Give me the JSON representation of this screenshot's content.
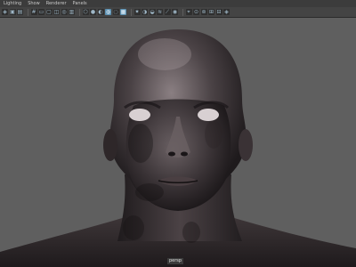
{
  "menubar": {
    "items": [
      "Lighting",
      "Show",
      "Renderer",
      "Panels"
    ]
  },
  "toolbar": {
    "icons": [
      {
        "name": "select-camera-icon",
        "glyph": "◈",
        "active": false
      },
      {
        "name": "bookmark-icon",
        "glyph": "▣",
        "active": false
      },
      {
        "name": "image-plane-icon",
        "glyph": "▤",
        "active": false
      },
      {
        "name": "grid-icon",
        "glyph": "#",
        "active": false
      },
      {
        "name": "film-gate-icon",
        "glyph": "▭",
        "active": false
      },
      {
        "name": "resolution-gate-icon",
        "glyph": "▢",
        "active": false
      },
      {
        "name": "gate-mask-icon",
        "glyph": "◫",
        "active": false
      },
      {
        "name": "field-chart-icon",
        "glyph": "◎",
        "active": false
      },
      {
        "name": "safe-action-icon",
        "glyph": "▥",
        "active": false
      },
      {
        "name": "wireframe-icon",
        "glyph": "⬡",
        "active": false
      },
      {
        "name": "smooth-shade-icon",
        "glyph": "●",
        "active": false
      },
      {
        "name": "default-material-icon",
        "glyph": "◐",
        "active": false
      },
      {
        "name": "wireframe-on-shaded-icon",
        "glyph": "◍",
        "active": true
      },
      {
        "name": "xray-icon",
        "glyph": "◌",
        "active": false
      },
      {
        "name": "textured-icon",
        "glyph": "▦",
        "active": true
      },
      {
        "name": "lights-icon",
        "glyph": "✷",
        "active": false
      },
      {
        "name": "shadows-icon",
        "glyph": "◑",
        "active": false
      },
      {
        "name": "ambient-occlusion-icon",
        "glyph": "◒",
        "active": false
      },
      {
        "name": "motion-blur-icon",
        "glyph": "≋",
        "active": false
      },
      {
        "name": "anti-aliasing-icon",
        "glyph": "⟋",
        "active": false
      },
      {
        "name": "depth-of-field-icon",
        "glyph": "◉",
        "active": false
      },
      {
        "name": "isolate-select-icon",
        "glyph": "⌖",
        "active": false
      },
      {
        "name": "xray-joints-icon",
        "glyph": "⊙",
        "active": false
      },
      {
        "name": "xray-active-icon",
        "glyph": "⊚",
        "active": false
      },
      {
        "name": "hud-icon",
        "glyph": "⊞",
        "active": false
      },
      {
        "name": "stereo-icon",
        "glyph": "⊟",
        "active": false
      },
      {
        "name": "color-management-icon",
        "glyph": "◈",
        "active": false
      }
    ]
  },
  "viewport": {
    "camera_label": "persp"
  },
  "colors": {
    "menubar_bg": "#3c3c3c",
    "toolbar_bg": "#444444",
    "viewport_bg": "#5f5f5f",
    "active_icon": "#5a8fb1"
  }
}
